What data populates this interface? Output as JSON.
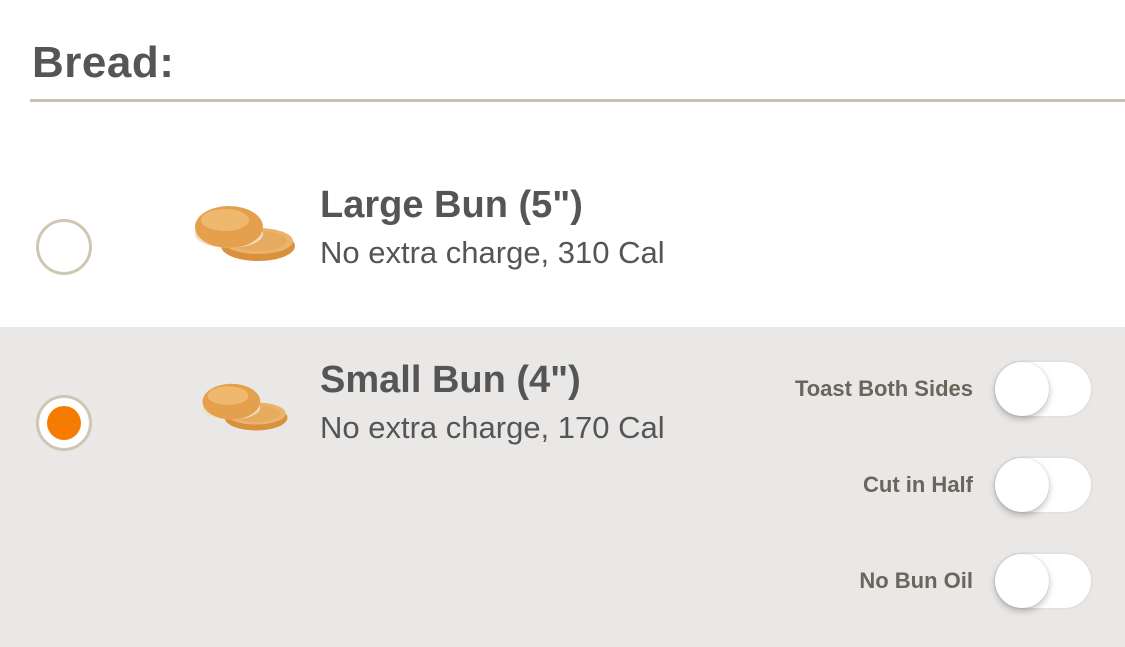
{
  "section": {
    "title": "Bread:"
  },
  "options": [
    {
      "title": "Large Bun (5\")",
      "subtitle": "No extra charge, 310 Cal",
      "selected": false,
      "icon": "bun-icon"
    },
    {
      "title": "Small Bun (4\")",
      "subtitle": "No extra charge, 170 Cal",
      "selected": true,
      "icon": "bun-icon",
      "modifiers": [
        {
          "label": "Toast Both Sides",
          "on": false
        },
        {
          "label": "Cut in Half",
          "on": false
        },
        {
          "label": "No Bun Oil",
          "on": false
        }
      ]
    }
  ],
  "colors": {
    "accent": "#f57c00",
    "divider": "#c9c1b0",
    "selected_row_bg": "#e9e8e6",
    "text": "#555555"
  }
}
